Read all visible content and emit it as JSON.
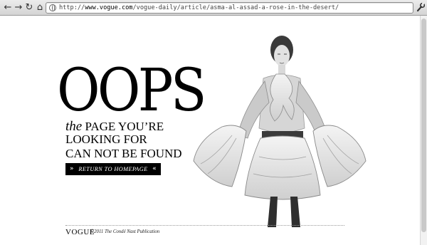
{
  "browser": {
    "back_icon": "←",
    "forward_icon": "→",
    "reload_icon": "↻",
    "home_icon": "⌂",
    "url_scheme": "http://",
    "url_host": "www.vogue.com",
    "url_path": "/vogue-daily/article/asma-al-assad-a-rose-in-the-desert/",
    "wrench_icon": "🔧"
  },
  "error": {
    "headline": "OOPS",
    "the": "the",
    "line1": "PAGE YOU’RE",
    "line2": "LOOKING FOR",
    "line3": "CAN NOT BE FOUND"
  },
  "home_button": {
    "label": "RETURN TO HOMEPAGE",
    "left_chevron": "»",
    "right_chevron": "«"
  },
  "footer": {
    "logo": "VOGUE",
    "copyright": "©2011 The Condé Nast Publication"
  },
  "colors": {
    "ink": "#000000",
    "page": "#ffffff"
  }
}
